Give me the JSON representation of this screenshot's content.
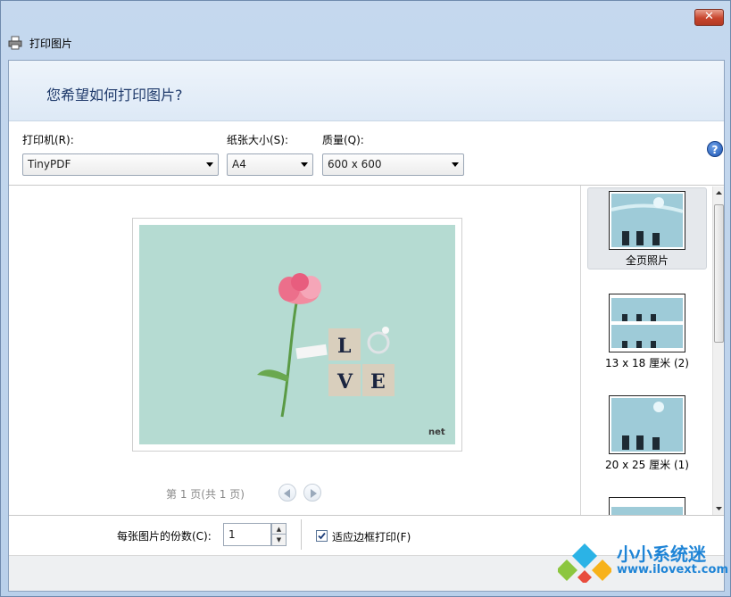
{
  "window": {
    "close_label": "✕"
  },
  "title": {
    "text": "打印图片"
  },
  "header": {
    "question": "您希望如何打印图片?"
  },
  "printer": {
    "label": "打印机(R):",
    "value": "TinyPDF"
  },
  "paper_size": {
    "label": "纸张大小(S):",
    "value": "A4"
  },
  "quality": {
    "label": "质量(Q):",
    "value": "600 x 600"
  },
  "help": {
    "icon": "help-icon",
    "glyph": "?"
  },
  "preview": {
    "photo_letters": [
      "L",
      "V",
      "E"
    ],
    "watermark": "net",
    "page_indicator": "第 1 页(共 1 页)"
  },
  "layouts": [
    {
      "label": "全页照片",
      "selected": true
    },
    {
      "label": "13 x 18 厘米 (2)",
      "selected": false
    },
    {
      "label": "20 x 25 厘米 (1)",
      "selected": false
    }
  ],
  "copies": {
    "label": "每张图片的份数(C):",
    "value": "1"
  },
  "fit_frame": {
    "label": "适应边框打印(F)",
    "checked": true
  },
  "brand": {
    "name": "小小系统迷",
    "url": "www.ilovext.com"
  },
  "colors": {
    "photo_bg": "#b5dbd2",
    "header_text": "#1f3a6b",
    "accent_blue": "#1d56b5"
  }
}
